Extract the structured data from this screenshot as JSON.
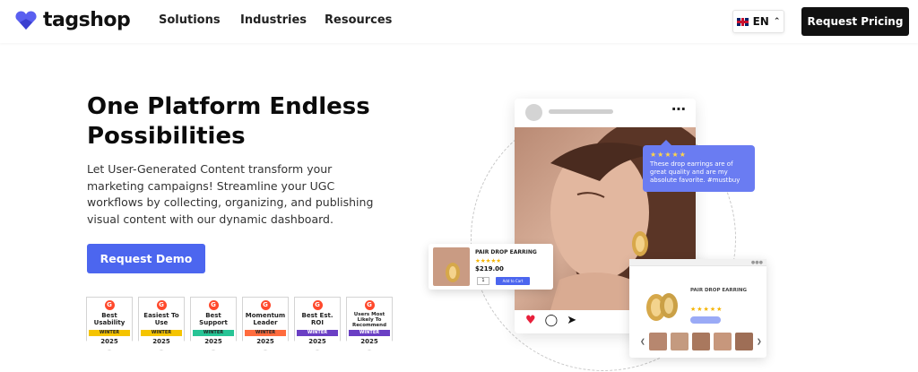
{
  "nav": {
    "brand": "tagshop",
    "links": [
      "Solutions",
      "Industries",
      "Resources"
    ],
    "language": "EN",
    "cta": "Request Pricing"
  },
  "hero": {
    "title": "One Platform Endless Possibilities",
    "description": "Let User-Generated Content transform your marketing campaigns! Streamline your UGC workflows by collecting, organizing, and publishing visual content with our dynamic dashboard.",
    "cta": "Request Demo"
  },
  "badges": [
    {
      "title": "Best Usability",
      "season": "WINTER",
      "year": "2025",
      "color": "#f5c400"
    },
    {
      "title": "Easiest To Use",
      "season": "WINTER",
      "year": "2025",
      "color": "#f5c400"
    },
    {
      "title": "Best Support",
      "season": "WINTER",
      "year": "2025",
      "color": "#27c495"
    },
    {
      "title": "Momentum Leader",
      "season": "WINTER",
      "year": "2025",
      "color": "#ff6b3d"
    },
    {
      "title": "Best Est. ROI",
      "season": "WINTER",
      "year": "2025",
      "color": "#6a3fc4"
    },
    {
      "title": "Users Most Likely To Recommend",
      "season": "WINTER",
      "year": "2025",
      "color": "#6a3fc4"
    }
  ],
  "review": {
    "stars": "★★★★★",
    "text": "These drop earrings are of great quality and are my absolute favorite. #mustbuy"
  },
  "product": {
    "name": "PAIR DROP EARRING",
    "stars": "★★★★★",
    "price": "$219.00",
    "qty": "1",
    "cart": "Add to Cart"
  },
  "panel": {
    "name": "PAIR DROP EARRING",
    "stars": "★★★★★"
  },
  "colors": {
    "accent": "#4c66ef",
    "dark": "#111111",
    "review_bg": "#6a7cf2"
  }
}
